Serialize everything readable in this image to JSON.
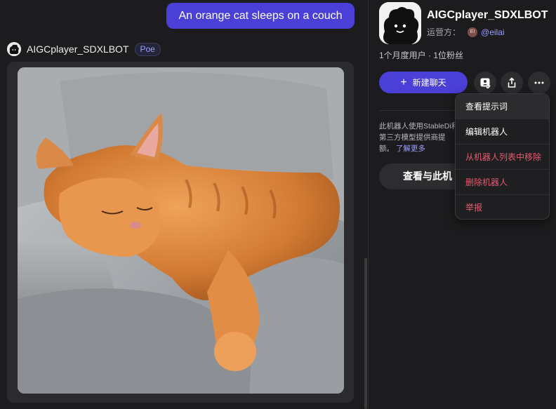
{
  "chat": {
    "user_message": "An orange cat sleeps on a couch",
    "bot_name": "AIGCplayer_SDXLBOT",
    "bot_badge": "Poe"
  },
  "bot_info": {
    "title": "AIGCplayer_SDXLBOT",
    "operator_label": "运营方：",
    "operator_initials": "EI",
    "operator_handle": "@eilai",
    "stats": "1个月度用户 · 1位粉丝",
    "new_chat_label": "新建聊天",
    "description": "此机器人使用StableDi和第三方模型提供商提额。",
    "learn_more": "了解更多",
    "view_button": "查看与此机"
  },
  "menu": {
    "items": [
      {
        "label": "查看提示词",
        "color": "#ffffff"
      },
      {
        "label": "编辑机器人",
        "color": "#ffffff"
      },
      {
        "label": "从机器人列表中移除",
        "color": "#e35b72"
      },
      {
        "label": "删除机器人",
        "color": "#e35b72"
      },
      {
        "label": "举报",
        "color": "#e35b72"
      }
    ]
  },
  "colors": {
    "accent": "#4a3fd6",
    "link": "#9b9eff",
    "danger": "#e35b72",
    "background": "#1c1c1e"
  },
  "icons": [
    "plus-icon",
    "bot-profile-icon",
    "share-icon",
    "more-icon"
  ]
}
